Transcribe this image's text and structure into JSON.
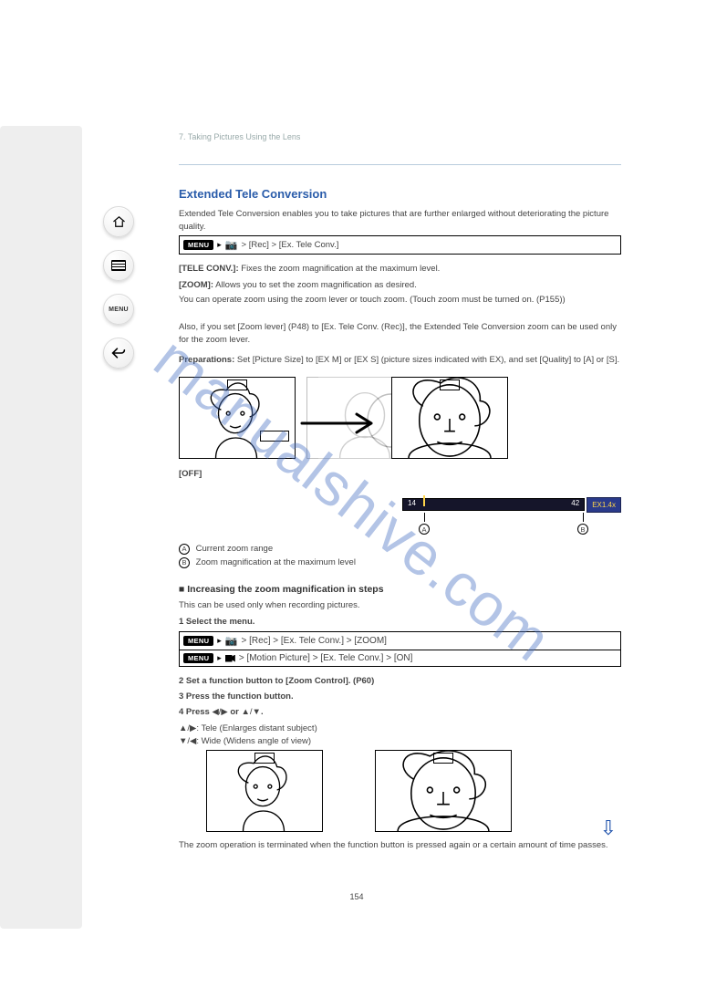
{
  "header": {
    "chapter": "7. Taking Pictures Using the Lens"
  },
  "section1": {
    "title": "Extended Tele Conversion",
    "intro": "Extended Tele Conversion enables you to take pictures that are further enlarged without deteriorating the picture quality.",
    "prep_heading": "Preparations:",
    "prep_body": "Set [Picture Size] to [EX M] or [EX S] (picture sizes indicated with EX), and set [Quality] to [A] or [S].",
    "menu_path": "> [Rec] > [Ex. Tele Conv.]",
    "opt_t": "[TELE CONV.]:",
    "opt_t_body": "Fixes the zoom magnification at the maximum level.",
    "opt_z": "[ZOOM]:",
    "opt_z_body1": "Allows you to set the zoom magnification as desired.",
    "opt_z_body2": " You can operate zoom using the zoom lever or touch zoom. (Touch zoom must be turned on. (P155))",
    "opt_z_body3": "Also, if you set [Zoom lever] (P48) to [Ex. Tele Conv. (Rec)], the Extended Tele Conversion zoom can be used only for the zoom lever.",
    "off": "[OFF]",
    "callout_a": "Current zoom range",
    "callout_b": "Zoom magnification at the maximum level",
    "fl_min": "14",
    "fl_max": "42",
    "fl_ex": "EX1.4x",
    "callout_a_letter": "A",
    "callout_b_letter": "B"
  },
  "section2": {
    "heading": "Increasing the zoom magnification in steps",
    "note": " This can be used only when recording pictures.",
    "step1": "1 Select the menu.",
    "menu1": "> [Rec] > [Ex. Tele Conv.] > [ZOOM]",
    "menu2": "> [Motion Picture] > [Ex. Tele Conv.] > [ON]",
    "step2": "2 Set a function button to [Zoom Control]. (P60)",
    "step3": "3 Press the function button.",
    "step4": "4 Press / or /.",
    "dir_tele": "Tele (Enlarges distant subject)",
    "dir_wide": "Wide (Widens angle of view)",
    "end": " The zoom operation is terminated when the function button is pressed again or a certain amount of time passes."
  },
  "nav": {
    "home": "home-icon",
    "toc": "toc-icon",
    "menu": "MENU",
    "back": "back-icon"
  },
  "page": "154"
}
